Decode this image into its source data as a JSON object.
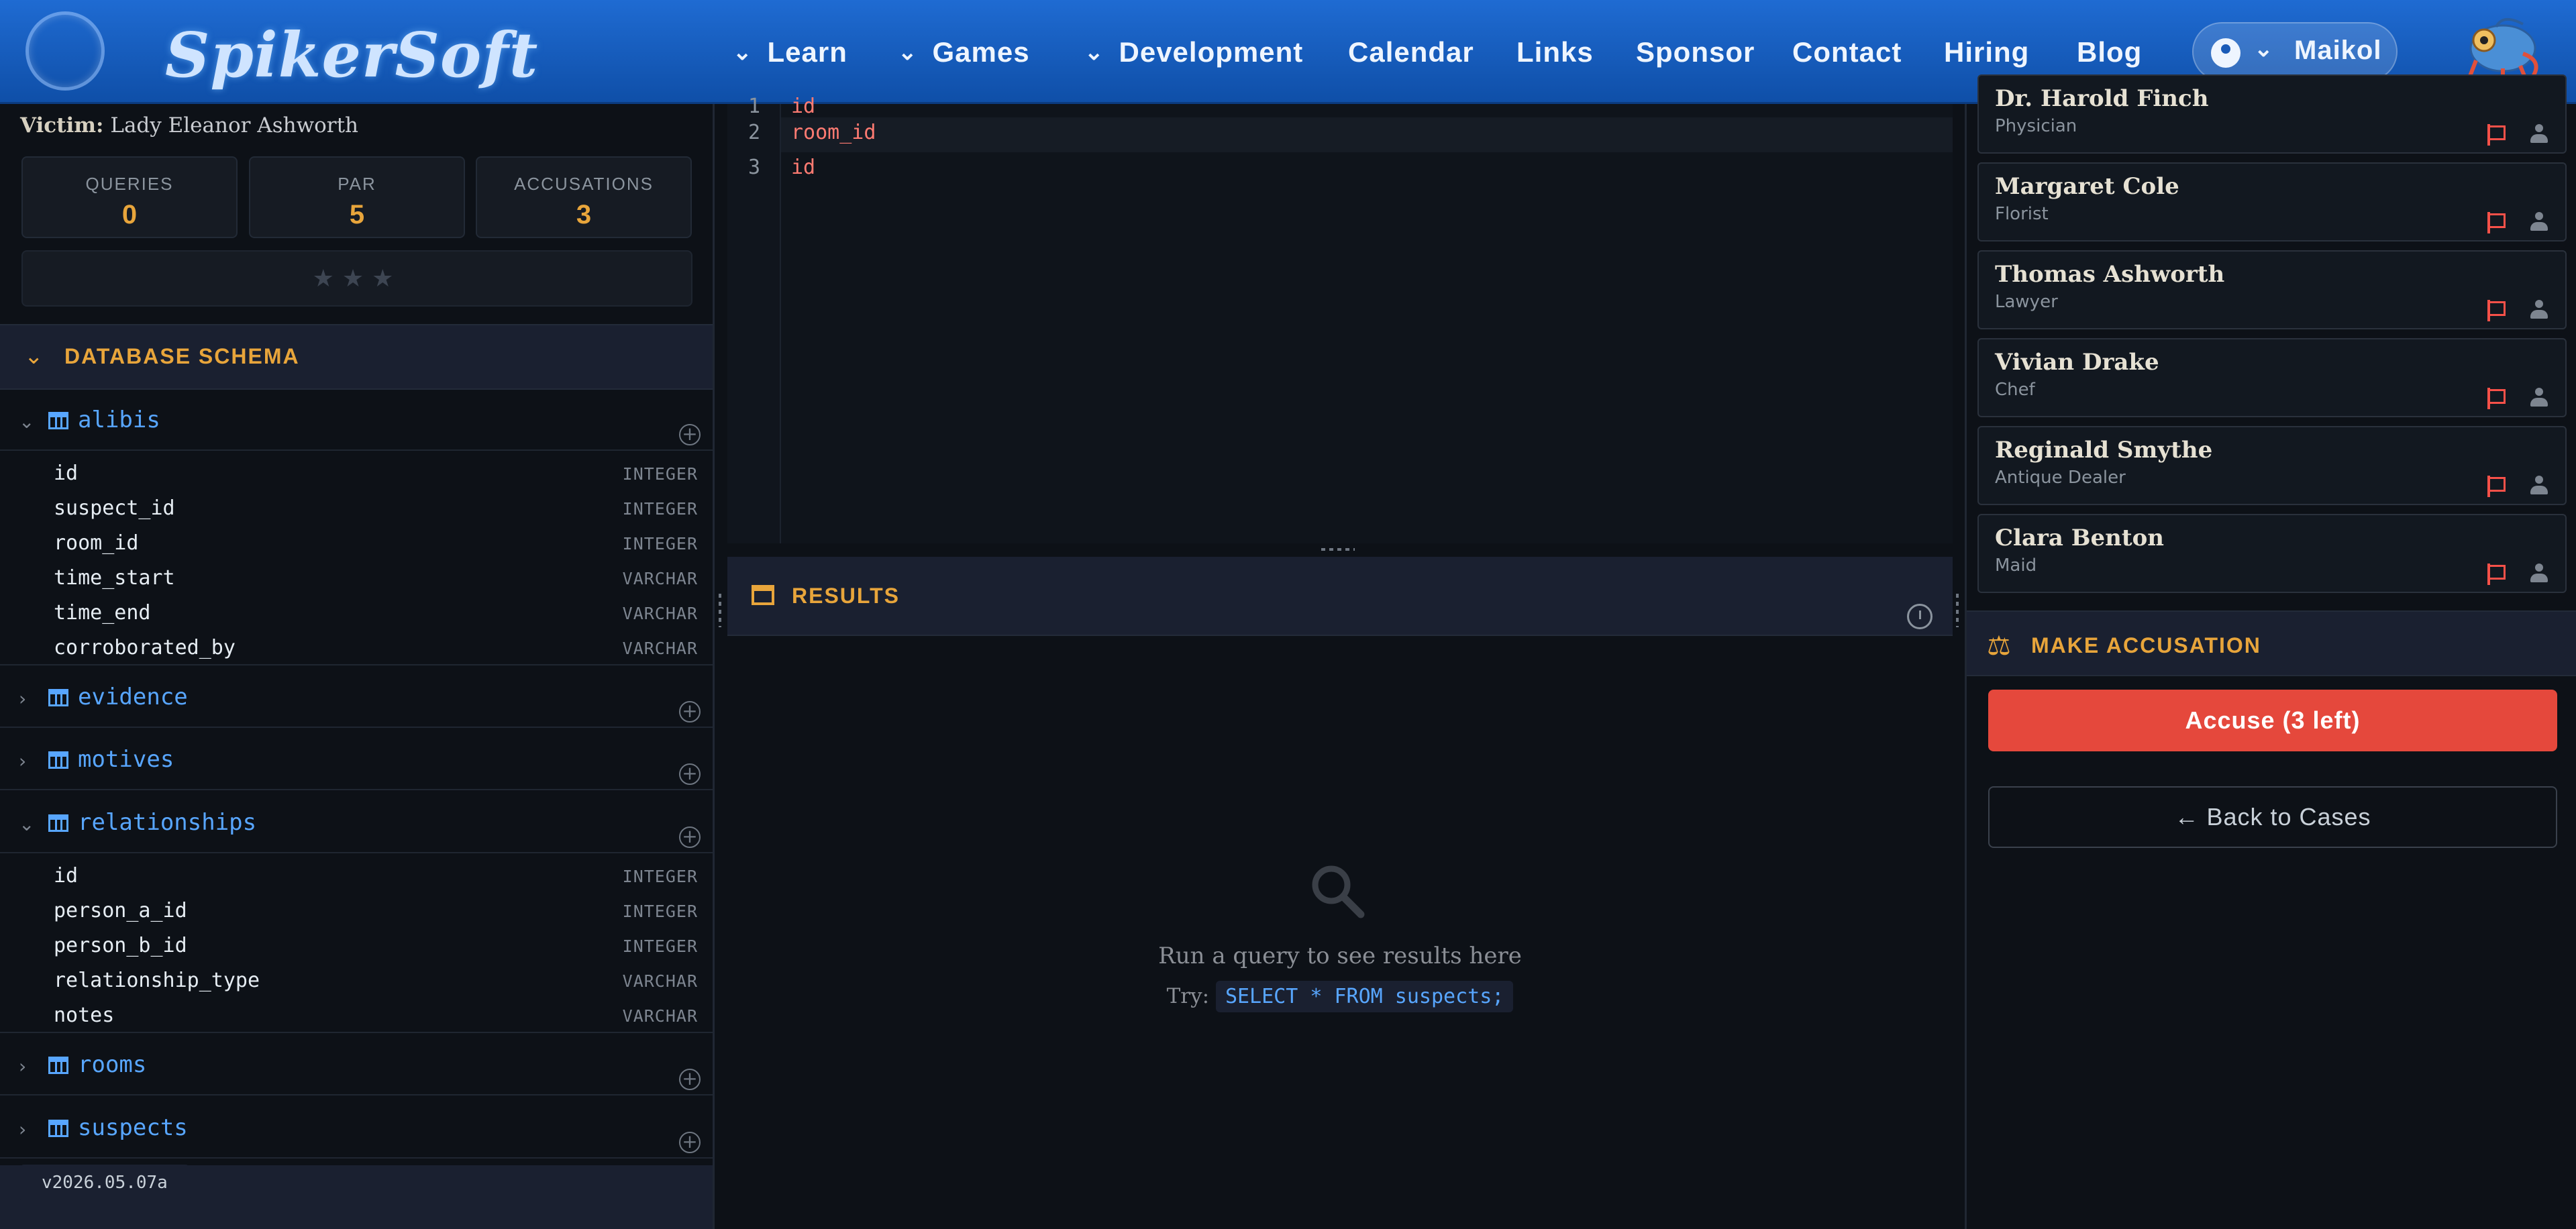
{
  "nav": {
    "brand": "SpikerSoft",
    "items": [
      {
        "label": "Learn",
        "dropdown": true
      },
      {
        "label": "Games",
        "dropdown": true
      },
      {
        "label": "Development",
        "dropdown": true
      },
      {
        "label": "Calendar",
        "dropdown": false
      },
      {
        "label": "Links",
        "dropdown": false
      },
      {
        "label": "Sponsor",
        "dropdown": false
      },
      {
        "label": "Contact",
        "dropdown": false
      },
      {
        "label": "Hiring",
        "dropdown": false
      },
      {
        "label": "Blog",
        "dropdown": false
      }
    ],
    "user": "Maikol",
    "chevron": "⌄"
  },
  "case": {
    "victim_label": "Victim:",
    "victim_name": "Lady Eleanor Ashworth",
    "stats": [
      {
        "label": "QUERIES",
        "value": "0"
      },
      {
        "label": "PAR",
        "value": "5"
      },
      {
        "label": "ACCUSATIONS",
        "value": "3"
      }
    ],
    "stars": "★★★"
  },
  "schema": {
    "title": "DATABASE SCHEMA",
    "tables": {
      "alibis": {
        "name": "alibis",
        "expanded": true,
        "columns": [
          {
            "name": "id",
            "type": "INTEGER"
          },
          {
            "name": "suspect_id",
            "type": "INTEGER"
          },
          {
            "name": "room_id",
            "type": "INTEGER"
          },
          {
            "name": "time_start",
            "type": "VARCHAR"
          },
          {
            "name": "time_end",
            "type": "VARCHAR"
          },
          {
            "name": "corroborated_by",
            "type": "VARCHAR"
          }
        ]
      },
      "evidence": {
        "name": "evidence",
        "expanded": false
      },
      "motives": {
        "name": "motives",
        "expanded": false
      },
      "relationships": {
        "name": "relationships",
        "expanded": true,
        "columns": [
          {
            "name": "id",
            "type": "INTEGER"
          },
          {
            "name": "person_a_id",
            "type": "INTEGER"
          },
          {
            "name": "person_b_id",
            "type": "INTEGER"
          },
          {
            "name": "relationship_type",
            "type": "VARCHAR"
          },
          {
            "name": "notes",
            "type": "VARCHAR"
          }
        ]
      },
      "rooms": {
        "name": "rooms",
        "expanded": false
      },
      "suspects": {
        "name": "suspects",
        "expanded": false
      }
    }
  },
  "version": "v2026.05.07a",
  "editor": {
    "lines": [
      {
        "num": "1",
        "text": "id"
      },
      {
        "num": "2",
        "text": "room_id"
      },
      {
        "num": "3",
        "text": "id"
      }
    ]
  },
  "results": {
    "title": "RESULTS",
    "empty_message": "Run a query to see results here",
    "try_label": "Try:",
    "try_query": "SELECT * FROM suspects;"
  },
  "suspects": [
    {
      "name": "Dr. Harold Finch",
      "role": "Physician"
    },
    {
      "name": "Margaret Cole",
      "role": "Florist"
    },
    {
      "name": "Thomas Ashworth",
      "role": "Lawyer"
    },
    {
      "name": "Vivian Drake",
      "role": "Chef"
    },
    {
      "name": "Reginald Smythe",
      "role": "Antique Dealer"
    },
    {
      "name": "Clara Benton",
      "role": "Maid"
    }
  ],
  "accusation": {
    "title": "MAKE ACCUSATION",
    "accuse_label": "Accuse (3 left)",
    "back_label": "← Back to Cases"
  },
  "colors": {
    "accent": "#e8a53b",
    "danger": "#e5483c",
    "link": "#58a6ff",
    "nav": "#1f6bd2"
  }
}
